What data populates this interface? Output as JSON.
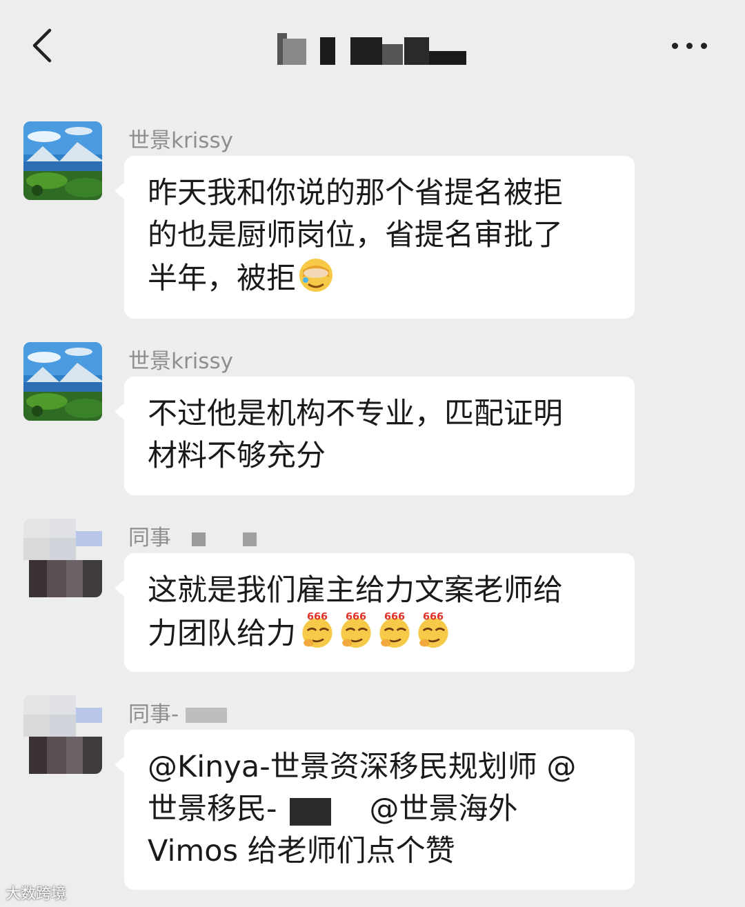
{
  "header": {
    "title": "",
    "back_icon": "chevron-left-icon",
    "more_icon": "more-dots-icon"
  },
  "messages": [
    {
      "sender": "世景krissy",
      "avatar": "landscape-avatar",
      "lines": [
        "昨天我和你说的那个省提名被拒",
        "的也是厨师岗位，省提名审批了",
        "半年，被拒"
      ],
      "emoji": "facepalm-emoji"
    },
    {
      "sender": "世景krissy",
      "avatar": "landscape-avatar",
      "lines": [
        "不过他是机构不专业，匹配证明",
        "材料不够充分"
      ]
    },
    {
      "sender": "同事",
      "avatar": "mosaic-avatar",
      "lines": [
        "这就是我们雇主给力文案老师给",
        "力团队给力"
      ],
      "emoji": "666-emoji",
      "emoji_label": "666"
    },
    {
      "sender": "同事-",
      "avatar": "mosaic-avatar",
      "lines": [
        "@Kinya-世景资深移民规划师 @",
        "世景移民-",
        "@世景海外",
        "Vimos  给老师们点个赞"
      ]
    }
  ],
  "watermark": "大数跨境",
  "colors": {
    "background": "#ededed",
    "bubble": "#ffffff",
    "sender": "#8e8e8e"
  }
}
